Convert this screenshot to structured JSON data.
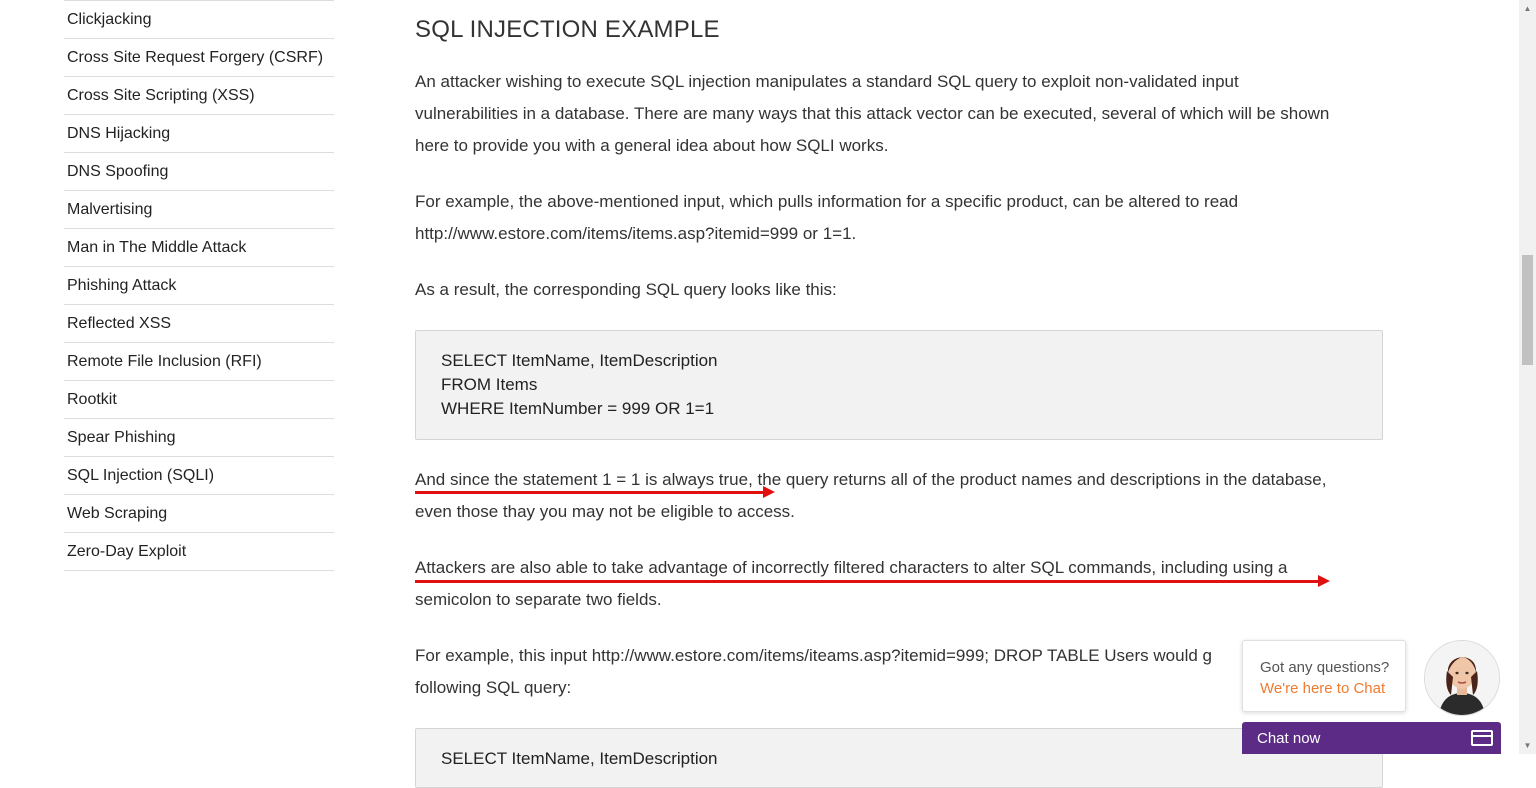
{
  "sidebar": {
    "items": [
      {
        "label": "Clickjacking"
      },
      {
        "label": "Cross Site Request Forgery (CSRF)"
      },
      {
        "label": "Cross Site Scripting (XSS)"
      },
      {
        "label": "DNS Hijacking"
      },
      {
        "label": "DNS Spoofing"
      },
      {
        "label": "Malvertising"
      },
      {
        "label": "Man in The Middle Attack"
      },
      {
        "label": "Phishing Attack"
      },
      {
        "label": "Reflected XSS"
      },
      {
        "label": "Remote File Inclusion (RFI)"
      },
      {
        "label": "Rootkit"
      },
      {
        "label": "Spear Phishing"
      },
      {
        "label": "SQL Injection (SQLI)"
      },
      {
        "label": "Web Scraping"
      },
      {
        "label": "Zero-Day Exploit"
      }
    ]
  },
  "article": {
    "heading": "SQL INJECTION EXAMPLE",
    "p1_line1": "An attacker wishing to execute SQL injection manipulates a standard SQL query to exploit non-validated input",
    "p1_line2": "vulnerabilities in a database. There are many ways that this attack vector can be executed, several of which will be shown",
    "p1_line3": "here to provide you with a general idea about how SQLI works.",
    "p2_line1": "For example, the above-mentioned input, which pulls information for a specific product, can be altered to read",
    "p2_line2": "http://www.estore.com/items/items.asp?itemid=999 or 1=1.",
    "p3": "As a result, the corresponding SQL query looks like this:",
    "code1": [
      "SELECT ItemName, ItemDescription",
      "FROM Items",
      "WHERE ItemNumber = 999 OR 1=1"
    ],
    "p4_line1": "And since the statement 1 = 1 is always true, the query returns all of the product names and descriptions in the database,",
    "p4_line2": "even those thay you may not be eligible to access.",
    "p5_line1": "Attackers are also able to take advantage of incorrectly filtered characters to alter SQL commands, including using a",
    "p5_line2": "semicolon to separate two fields.",
    "p6_line1": "For example, this input http://www.estore.com/items/iteams.asp?itemid=999; DROP TABLE Users would g",
    "p6_line2": "following SQL query:",
    "code2_partial": "SELECT ItemName, ItemDescription"
  },
  "chat": {
    "question": "Got any questions?",
    "here": "We're here to Chat",
    "bar_label": "Chat now"
  },
  "colors": {
    "arrow": "#e01010",
    "chat_bar": "#5b2b86",
    "chat_accent": "#f07b2f",
    "code_bg": "#f2f2f2"
  }
}
